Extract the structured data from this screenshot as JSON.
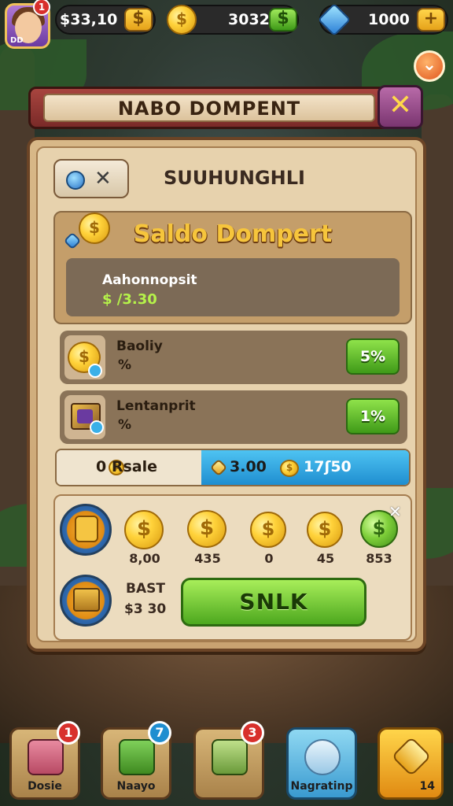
{
  "top_bar": {
    "avatar_notification": "1",
    "avatar_level": "DD",
    "coins_value": "$33,10",
    "coins_plus": "$",
    "mid_value": "3032",
    "gems_value": "1000",
    "gems_plus": "+",
    "dropdown_arrow": "⌄"
  },
  "dialog": {
    "title": "NABO DOMPENT",
    "close": "✕",
    "subtitle": "SUUHUNGHLI",
    "tab_close": "✕",
    "saldo_title": "Saldo Dompert",
    "saldo_label": "Aahonnopsit",
    "saldo_amount": "$ /3.30",
    "rows": [
      {
        "name": "Baoliy",
        "sub": "%",
        "percent": "5%"
      },
      {
        "name": "Lentanprit",
        "sub": "%",
        "percent": "1%"
      }
    ],
    "split": {
      "left": "0 Rsale",
      "right_a": "3.00",
      "right_b": "17ʃ50"
    },
    "rewards": {
      "items": [
        {
          "value": "8,00",
          "coin": "$",
          "color": "gold"
        },
        {
          "value": "435",
          "coin": "$",
          "color": "gold"
        },
        {
          "value": "0",
          "coin": "$",
          "color": "gold"
        },
        {
          "value": "45",
          "coin": "$",
          "color": "gold"
        },
        {
          "value": "853",
          "coin": "$",
          "color": "green"
        }
      ],
      "close": "✕",
      "best_label": "BAST",
      "best_value": "$3 30",
      "spin_label": "SNLK"
    }
  },
  "bottom_nav": [
    {
      "label": "Dosie",
      "badge": "1",
      "badge_color": "#d8302c"
    },
    {
      "label": "Naayo",
      "badge": "7",
      "badge_color": "#1f8ed0"
    },
    {
      "label": "",
      "badge": "3",
      "badge_color": "#d8302c"
    },
    {
      "label": "Nagratinp",
      "badge": "",
      "badge_color": ""
    },
    {
      "label": "14",
      "badge": "",
      "badge_color": ""
    }
  ],
  "colors": {
    "accent_gold": "#f6c53c",
    "accent_green": "#4da81e",
    "accent_blue": "#1f8ed0",
    "header_red": "#a8453f"
  }
}
